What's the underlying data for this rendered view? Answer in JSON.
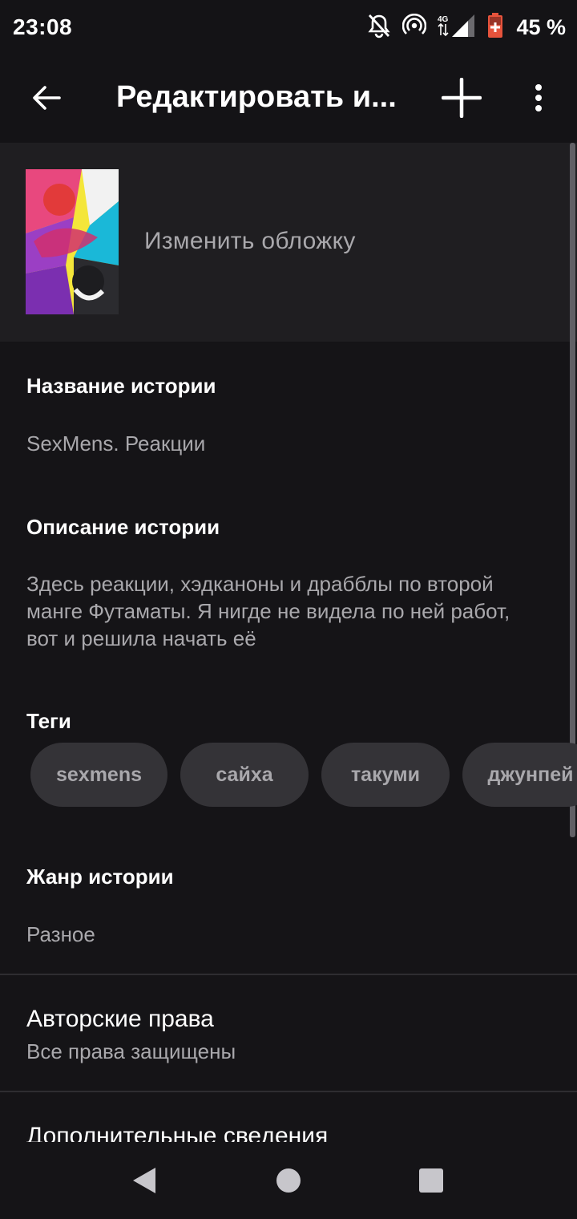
{
  "status_bar": {
    "time": "23:08",
    "battery": "45 %"
  },
  "app_bar": {
    "title": "Редактировать и..."
  },
  "cover": {
    "change_label": "Изменить обложку"
  },
  "title_field": {
    "label": "Название истории",
    "value": "SexMens. Реакции"
  },
  "description_field": {
    "label": "Описание истории",
    "lines": [
      "Здесь реакции, хэдканоны и драбблы по второй",
      "манге Футаматы. Я нигде не видела по ней работ,",
      "вот и решила начать её"
    ]
  },
  "tags": {
    "label": "Теги",
    "items": [
      "sexmens",
      "сайха",
      "такуми",
      "джунпей"
    ]
  },
  "genre_field": {
    "label": "Жанр истории",
    "value": "Разное"
  },
  "copyright": {
    "title": "Авторские права",
    "value": "Все права защищены"
  },
  "extra": {
    "title": "Дополнительные сведения"
  },
  "colors": {
    "background": "#151417",
    "surface": "#1f1e21",
    "chip": "#343337",
    "secondary_text": "#a9a8ac"
  },
  "icons": [
    "mute-bell-icon",
    "hotspot-icon",
    "signal-4g-icon",
    "battery-icon",
    "back-arrow-icon",
    "plus-icon",
    "more-vert-icon",
    "nav-back-icon",
    "nav-home-icon",
    "nav-recents-icon"
  ]
}
